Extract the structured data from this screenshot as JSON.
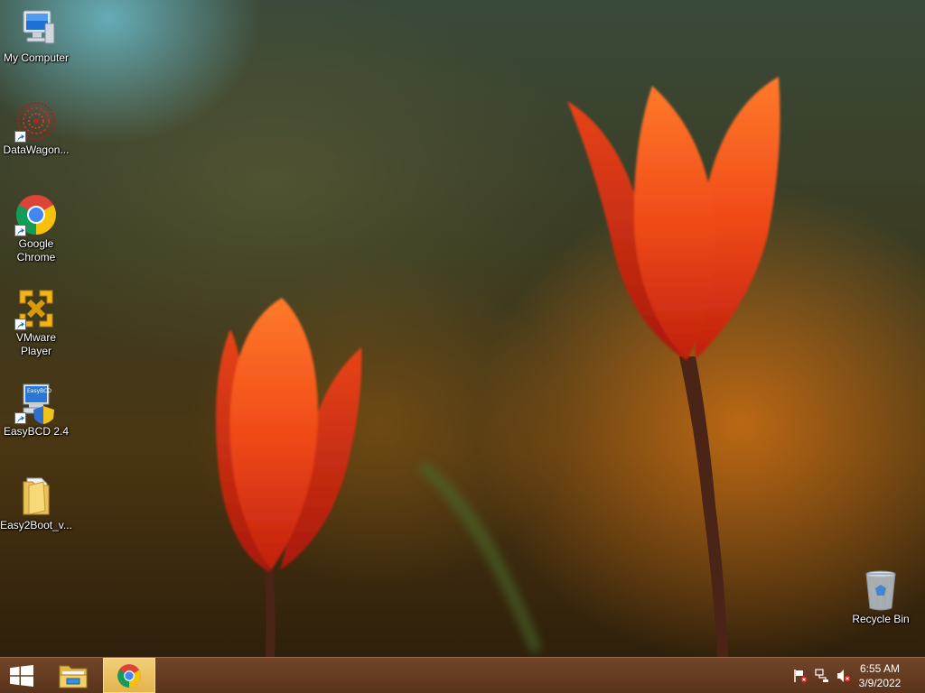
{
  "desktop": {
    "icons": [
      {
        "label": "My Computer",
        "icon": "computer-icon"
      },
      {
        "label": "DataWagon...",
        "icon": "datawagon-icon"
      },
      {
        "label": "Google Chrome",
        "icon": "chrome-icon"
      },
      {
        "label": "VMware Player",
        "icon": "vmware-icon"
      },
      {
        "label": "EasyBCD 2.4",
        "icon": "easybcd-icon"
      },
      {
        "label": "Easy2Boot_v...",
        "icon": "folder-icon"
      },
      {
        "label": "Recycle Bin",
        "icon": "recycle-bin-icon"
      }
    ],
    "easybcd_screen_text": "EasyBCD"
  },
  "taskbar": {
    "start_icon": "windows-logo-icon",
    "pinned": [
      {
        "name": "File Explorer",
        "icon": "folder-icon"
      },
      {
        "name": "Google Chrome",
        "icon": "chrome-icon",
        "active": true
      }
    ],
    "tray": {
      "icons": [
        "action-center-flag-icon",
        "network-icon",
        "speaker-muted-icon"
      ],
      "time": "6:55 AM",
      "date": "3/9/2022"
    }
  },
  "colors": {
    "taskbar": "#7a4a2c",
    "active_task": "#e8bf5c",
    "tulip": "#e8431c"
  }
}
